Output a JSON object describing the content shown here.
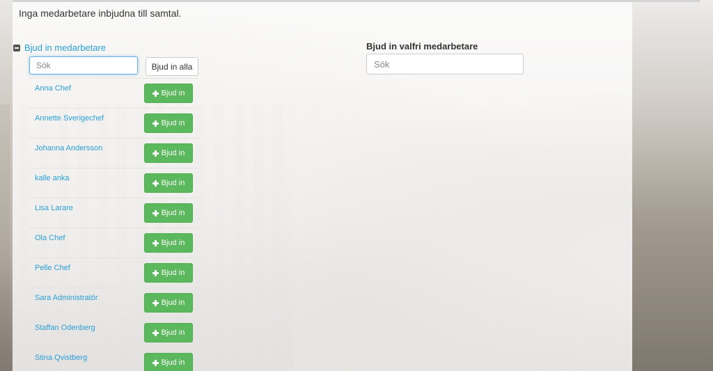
{
  "notice": "Inga medarbetare inbjudna till samtal.",
  "invite_section": {
    "toggle_label": "Bjud in medarbetare",
    "search_placeholder": "Sök",
    "invite_all_label": "Bjud in alla",
    "invite_button_label": "Bjud in",
    "employees": [
      {
        "name": "Anna Chef"
      },
      {
        "name": "Annette Sverigechef"
      },
      {
        "name": "Johanna Andersson"
      },
      {
        "name": "kalle anka"
      },
      {
        "name": "Lisa Larare"
      },
      {
        "name": "Ola Chef"
      },
      {
        "name": "Pelle Chef"
      },
      {
        "name": "Sara Administratör"
      },
      {
        "name": "Staffan Odenberg"
      },
      {
        "name": "Stina Qvistberg"
      }
    ]
  },
  "any_employee": {
    "title": "Bjud in valfri medarbetare",
    "search_placeholder": "Sök"
  },
  "colors": {
    "link": "#2a9fd6",
    "success": "#5cb85c"
  },
  "icons": {
    "collapse": "minus-square-icon",
    "invite": "plus-icon"
  }
}
